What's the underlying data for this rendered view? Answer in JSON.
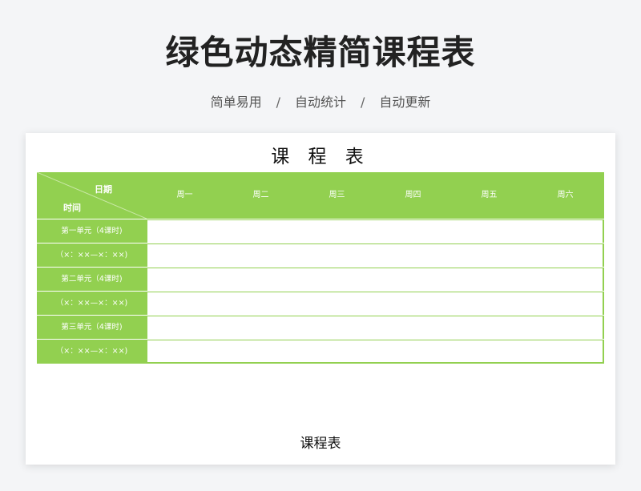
{
  "header": {
    "title": "绿色动态精简课程表",
    "subtitle_items": [
      "简单易用",
      "自动统计",
      "自动更新"
    ],
    "separator": "/"
  },
  "sheet": {
    "title": "课 程 表",
    "corner": {
      "date_label": "日期",
      "time_label": "时间"
    },
    "days": [
      "周一",
      "周二",
      "周三",
      "周四",
      "周五",
      "周六"
    ],
    "rows": [
      "第一单元（4课时)",
      "（×：××—×：××)",
      "第二单元（4课时)",
      "（×：××—×：××)",
      "第三单元（4课时)",
      "（×：××—×：××)"
    ],
    "footer": "课程表"
  },
  "colors": {
    "accent": "#92d050",
    "background": "#f4f5f7"
  }
}
